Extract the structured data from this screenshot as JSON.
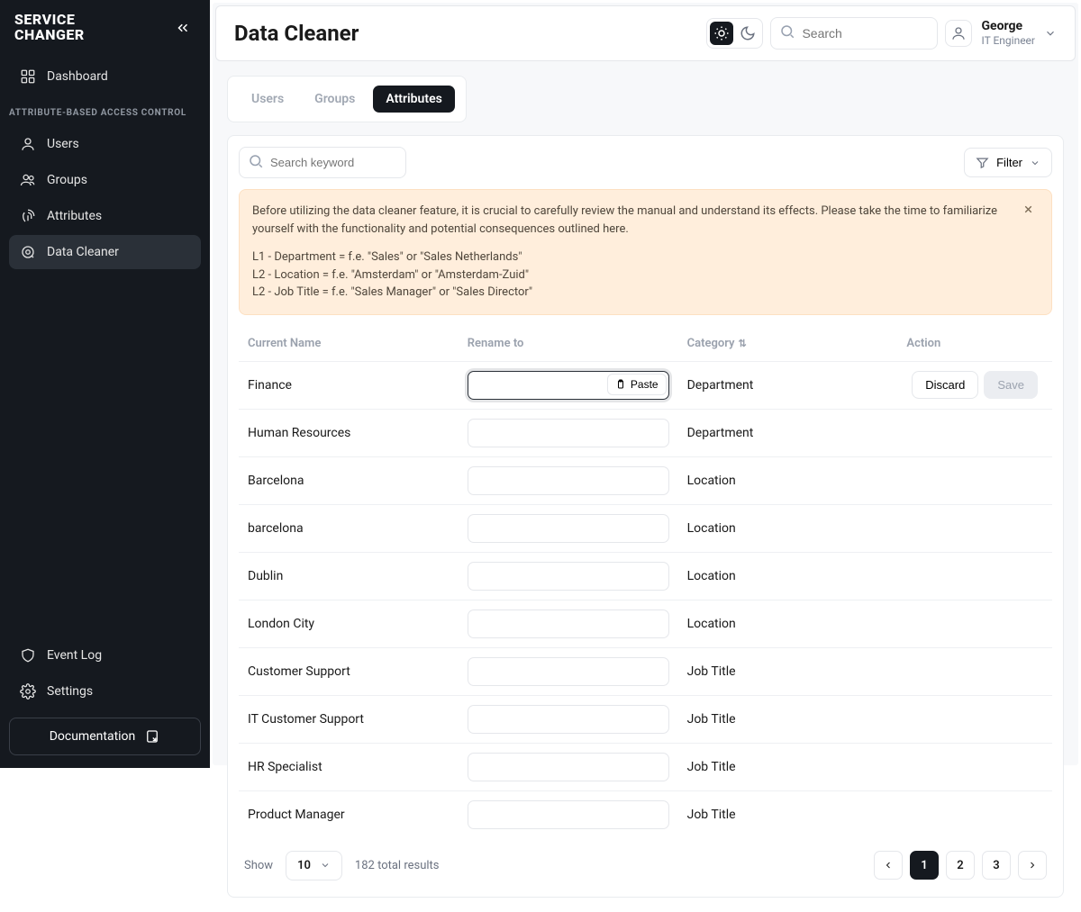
{
  "brand": "SERVICE\nCHANGER",
  "page_title": "Data Cleaner",
  "search": {
    "placeholder": "Search"
  },
  "user": {
    "name": "George",
    "role": "IT Engineer"
  },
  "nav": {
    "dashboard": "Dashboard",
    "section_label": "ATTRIBUTE-BASED ACCESS CONTROL",
    "items": [
      "Users",
      "Groups",
      "Attributes",
      "Data Cleaner"
    ],
    "bottom": [
      "Event Log",
      "Settings"
    ],
    "documentation": "Documentation"
  },
  "tabs": [
    "Users",
    "Groups",
    "Attributes"
  ],
  "keyword_placeholder": "Search keyword",
  "filter_label": "Filter",
  "banner": {
    "text": "Before utilizing the data cleaner feature, it is crucial to carefully review the manual and understand its effects. Please take the time to familiarize yourself with the functionality and potential consequences outlined here.",
    "lines": [
      "L1 - Department = f.e. \"Sales\" or \"Sales Netherlands\"",
      "L2 - Location = f.e. \"Amsterdam\" or \"Amsterdam-Zuid\"",
      "L2 - Job Title = f.e. \"Sales Manager\" or \"Sales Director\""
    ]
  },
  "columns": {
    "current": "Current Name",
    "rename": "Rename to",
    "category": "Category",
    "action": "Action"
  },
  "rows": [
    {
      "name": "Finance",
      "category": "Department",
      "active": true
    },
    {
      "name": "Human Resources",
      "category": "Department"
    },
    {
      "name": "Barcelona",
      "category": "Location"
    },
    {
      "name": "barcelona",
      "category": "Location"
    },
    {
      "name": "Dublin",
      "category": "Location"
    },
    {
      "name": "London City",
      "category": "Location"
    },
    {
      "name": "Customer Support",
      "category": "Job Title"
    },
    {
      "name": "IT Customer Support",
      "category": "Job Title"
    },
    {
      "name": "HR Specialist",
      "category": "Job Title"
    },
    {
      "name": "Product Manager",
      "category": "Job Title"
    }
  ],
  "actions": {
    "discard": "Discard",
    "save": "Save",
    "paste": "Paste"
  },
  "pager": {
    "show": "Show",
    "size": "10",
    "total": "182 total results",
    "pages": [
      "1",
      "2",
      "3"
    ]
  }
}
